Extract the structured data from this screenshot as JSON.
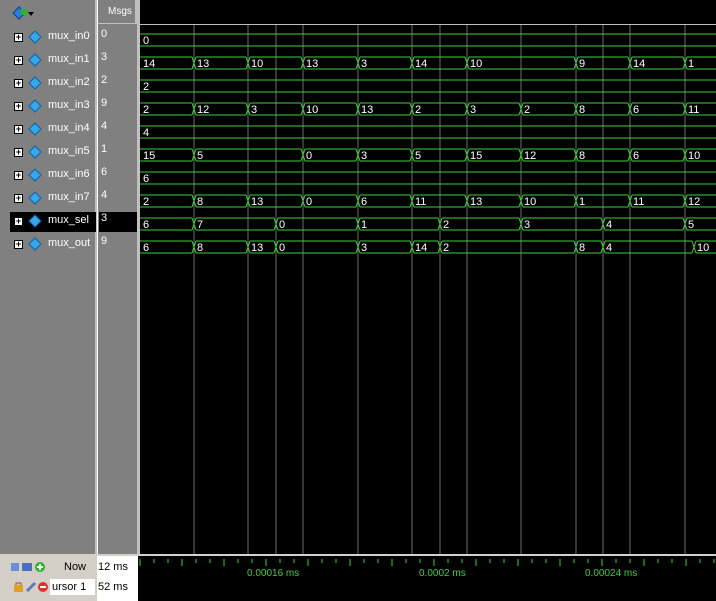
{
  "header": {
    "values_title": "Msgs"
  },
  "signals": [
    {
      "name": "mux_in0",
      "value": "0",
      "transitions": [
        {
          "t": 0,
          "v": "0"
        }
      ]
    },
    {
      "name": "mux_in1",
      "value": "3",
      "transitions": [
        {
          "t": 0,
          "v": "14"
        },
        {
          "t": 54,
          "v": "13"
        },
        {
          "t": 108,
          "v": "10"
        },
        {
          "t": 163,
          "v": "13"
        },
        {
          "t": 218,
          "v": "3"
        },
        {
          "t": 272,
          "v": "14"
        },
        {
          "t": 327,
          "v": "10"
        },
        {
          "t": 436,
          "v": "9"
        },
        {
          "t": 490,
          "v": "14"
        },
        {
          "t": 545,
          "v": "1"
        }
      ]
    },
    {
      "name": "mux_in2",
      "value": "2",
      "transitions": [
        {
          "t": 0,
          "v": "2"
        }
      ]
    },
    {
      "name": "mux_in3",
      "value": "9",
      "transitions": [
        {
          "t": 0,
          "v": "2"
        },
        {
          "t": 54,
          "v": "12"
        },
        {
          "t": 108,
          "v": "3"
        },
        {
          "t": 163,
          "v": "10"
        },
        {
          "t": 218,
          "v": "13"
        },
        {
          "t": 272,
          "v": "2"
        },
        {
          "t": 327,
          "v": "3"
        },
        {
          "t": 381,
          "v": "2"
        },
        {
          "t": 436,
          "v": "8"
        },
        {
          "t": 490,
          "v": "6"
        },
        {
          "t": 545,
          "v": "11"
        }
      ]
    },
    {
      "name": "mux_in4",
      "value": "4",
      "transitions": [
        {
          "t": 0,
          "v": "4"
        }
      ]
    },
    {
      "name": "mux_in5",
      "value": "1",
      "transitions": [
        {
          "t": 0,
          "v": "15"
        },
        {
          "t": 54,
          "v": "5"
        },
        {
          "t": 163,
          "v": "0"
        },
        {
          "t": 218,
          "v": "3"
        },
        {
          "t": 272,
          "v": "5"
        },
        {
          "t": 327,
          "v": "15"
        },
        {
          "t": 381,
          "v": "12"
        },
        {
          "t": 436,
          "v": "8"
        },
        {
          "t": 490,
          "v": "6"
        },
        {
          "t": 545,
          "v": "10"
        }
      ]
    },
    {
      "name": "mux_in6",
      "value": "6",
      "transitions": [
        {
          "t": 0,
          "v": "6"
        }
      ]
    },
    {
      "name": "mux_in7",
      "value": "4",
      "transitions": [
        {
          "t": 0,
          "v": "2"
        },
        {
          "t": 54,
          "v": "8"
        },
        {
          "t": 108,
          "v": "13"
        },
        {
          "t": 163,
          "v": "0"
        },
        {
          "t": 218,
          "v": "6"
        },
        {
          "t": 272,
          "v": "11"
        },
        {
          "t": 327,
          "v": "13"
        },
        {
          "t": 381,
          "v": "10"
        },
        {
          "t": 436,
          "v": "1"
        },
        {
          "t": 490,
          "v": "11"
        },
        {
          "t": 545,
          "v": "12"
        }
      ]
    },
    {
      "name": "mux_sel",
      "value": "3",
      "selected": true,
      "transitions": [
        {
          "t": 0,
          "v": "6"
        },
        {
          "t": 54,
          "v": "7"
        },
        {
          "t": 136,
          "v": "0"
        },
        {
          "t": 218,
          "v": "1"
        },
        {
          "t": 300,
          "v": "2"
        },
        {
          "t": 381,
          "v": "3"
        },
        {
          "t": 463,
          "v": "4"
        },
        {
          "t": 545,
          "v": "5"
        }
      ]
    },
    {
      "name": "mux_out",
      "value": "9",
      "transitions": [
        {
          "t": 0,
          "v": "6"
        },
        {
          "t": 54,
          "v": "8"
        },
        {
          "t": 108,
          "v": "13"
        },
        {
          "t": 136,
          "v": "0"
        },
        {
          "t": 218,
          "v": "3"
        },
        {
          "t": 272,
          "v": "14"
        },
        {
          "t": 300,
          "v": "2"
        },
        {
          "t": 436,
          "v": "8"
        },
        {
          "t": 463,
          "v": "4"
        },
        {
          "t": 554,
          "v": "10"
        }
      ]
    }
  ],
  "grid": {
    "line_color": "#b7b7b7"
  },
  "colors": {
    "wave": "#3bd13b",
    "background": "#000000",
    "panel": "#808080",
    "text_light": "#ffffff"
  },
  "footer": {
    "now_label": "Now",
    "now_value": "12 ms",
    "cursor_label": "ursor 1",
    "cursor_value": "52 ms",
    "time_labels": [
      "0.00016 ms",
      "0.0002 ms",
      "0.00024 ms"
    ]
  },
  "icons": {
    "expand": "+",
    "signal": "diamond-icon"
  }
}
